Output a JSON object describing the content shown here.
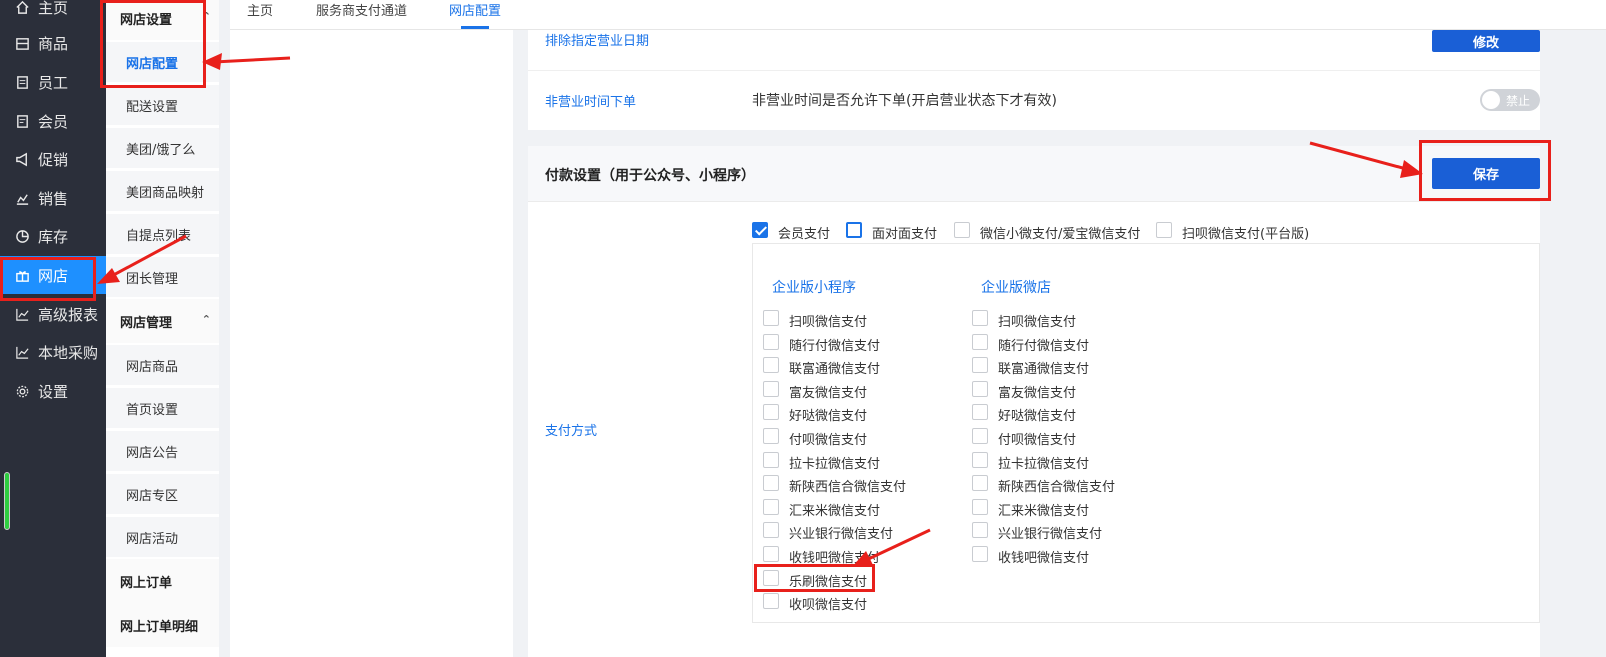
{
  "nav": {
    "items": [
      {
        "label": "主页",
        "icon": "home-icon"
      },
      {
        "label": "商品",
        "icon": "goods-icon"
      },
      {
        "label": "员工",
        "icon": "staff-icon"
      },
      {
        "label": "会员",
        "icon": "member-icon"
      },
      {
        "label": "促销",
        "icon": "megaphone-icon"
      },
      {
        "label": "销售",
        "icon": "sales-chart-icon"
      },
      {
        "label": "库存",
        "icon": "pie-chart-icon"
      },
      {
        "label": "网店",
        "icon": "gift-icon"
      },
      {
        "label": "高级报表",
        "icon": "line-chart-icon"
      },
      {
        "label": "本地采购",
        "icon": "trend-icon"
      },
      {
        "label": "设置",
        "icon": "gear-icon"
      }
    ],
    "active": "网店"
  },
  "submenu": {
    "group1": "网店设置",
    "group1_items": [
      "网店配置",
      "配送设置",
      "美团/饿了么",
      "美团商品映射",
      "自提点列表",
      "团长管理"
    ],
    "group2": "网店管理",
    "group2_items": [
      "网店商品",
      "首页设置",
      "网店公告",
      "网店专区",
      "网店活动"
    ],
    "group3": "网上订单",
    "group4": "网上订单明细"
  },
  "tabs": [
    "主页",
    "服务商支付通道",
    "网店配置"
  ],
  "active_tab": "网店配置",
  "business_section": {
    "partial_row_label": "排除指定营业日期",
    "partial_button": "修改",
    "row_label": "非营业时间下单",
    "row_text": "非营业时间是否允许下单(开启营业状态下才有效)",
    "toggle_text": "禁止"
  },
  "payment_section": {
    "title": "付款设置（用于公众号、小程序）",
    "save_button": "保存",
    "pay_method_label": "支付方式",
    "top_options": [
      {
        "label": "会员支付",
        "checked": true
      },
      {
        "label": "面对面支付",
        "checked": false
      },
      {
        "label": "微信小微支付/爱宝微信支付",
        "checked": false
      },
      {
        "label": "扫呗微信支付(平台版)",
        "checked": false
      }
    ],
    "col1_title": "企业版小程序",
    "col2_title": "企业版微店",
    "col1_items": [
      "扫呗微信支付",
      "随行付微信支付",
      "联富通微信支付",
      "富友微信支付",
      "好哒微信支付",
      "付呗微信支付",
      "拉卡拉微信支付",
      "新陕西信合微信支付",
      "汇来米微信支付",
      "兴业银行微信支付",
      "收钱吧微信支付",
      "乐刷微信支付",
      "收呗微信支付"
    ],
    "col2_items": [
      "扫呗微信支付",
      "随行付微信支付",
      "联富通微信支付",
      "富友微信支付",
      "好哒微信支付",
      "付呗微信支付",
      "拉卡拉微信支付",
      "新陕西信合微信支付",
      "汇来米微信支付",
      "兴业银行微信支付",
      "收钱吧微信支付"
    ]
  },
  "colors": {
    "accent": "#1a73e8",
    "annotation_red": "#e8201b",
    "nav_bg": "#2b2f3a"
  }
}
